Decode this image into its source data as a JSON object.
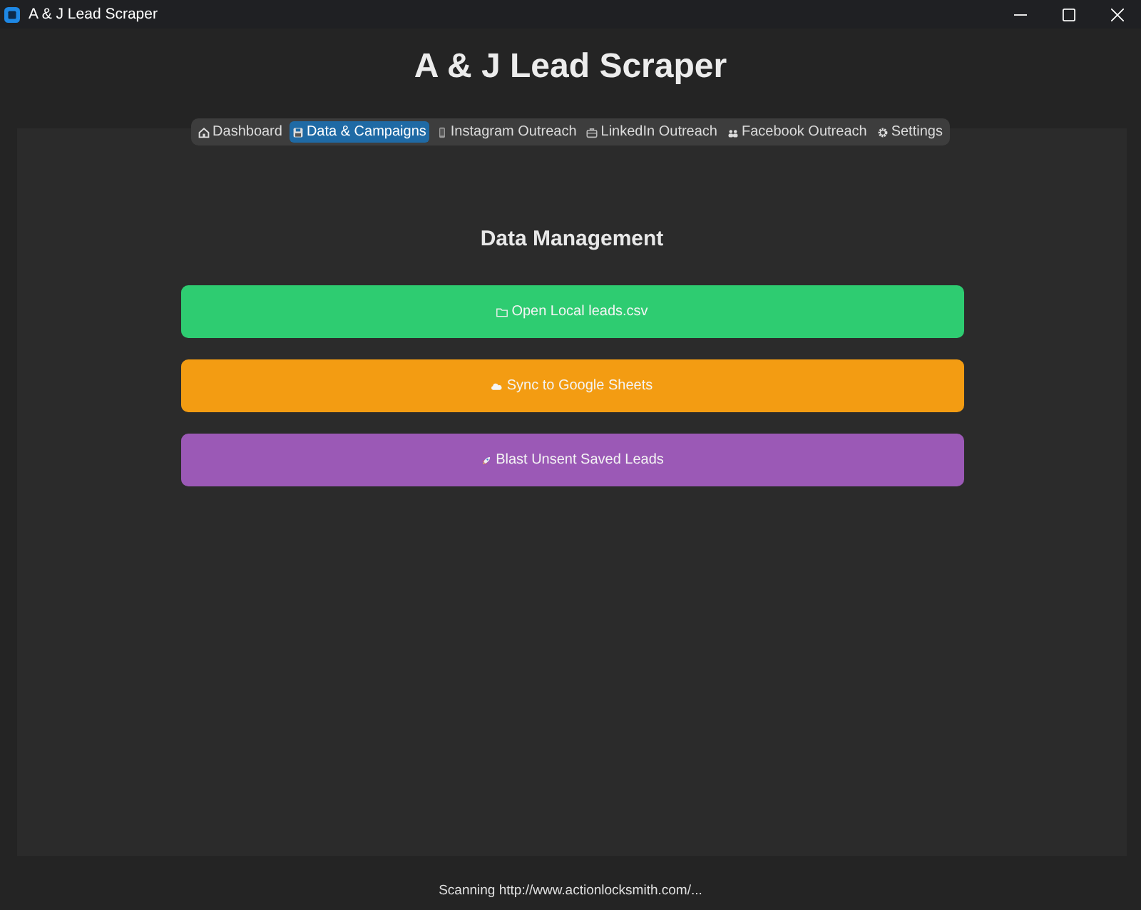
{
  "window": {
    "title": "A & J Lead Scraper"
  },
  "app_title": "A & J Lead Scraper",
  "tabs": [
    {
      "label": "Dashboard",
      "selected": false
    },
    {
      "label": "Data & Campaigns",
      "selected": true
    },
    {
      "label": "Instagram Outreach",
      "selected": false
    },
    {
      "label": "LinkedIn Outreach",
      "selected": false
    },
    {
      "label": "Facebook Outreach",
      "selected": false
    },
    {
      "label": "Settings",
      "selected": false
    }
  ],
  "section": {
    "title": "Data Management",
    "actions": [
      {
        "label": "Open Local leads.csv",
        "color": "#2ecc71"
      },
      {
        "label": "Sync to Google Sheets",
        "color": "#f39c12"
      },
      {
        "label": "Blast Unsent Saved Leads",
        "color": "#9b59b6"
      }
    ]
  },
  "status_bar": {
    "text": "Scanning http://www.actionlocksmith.com/..."
  }
}
